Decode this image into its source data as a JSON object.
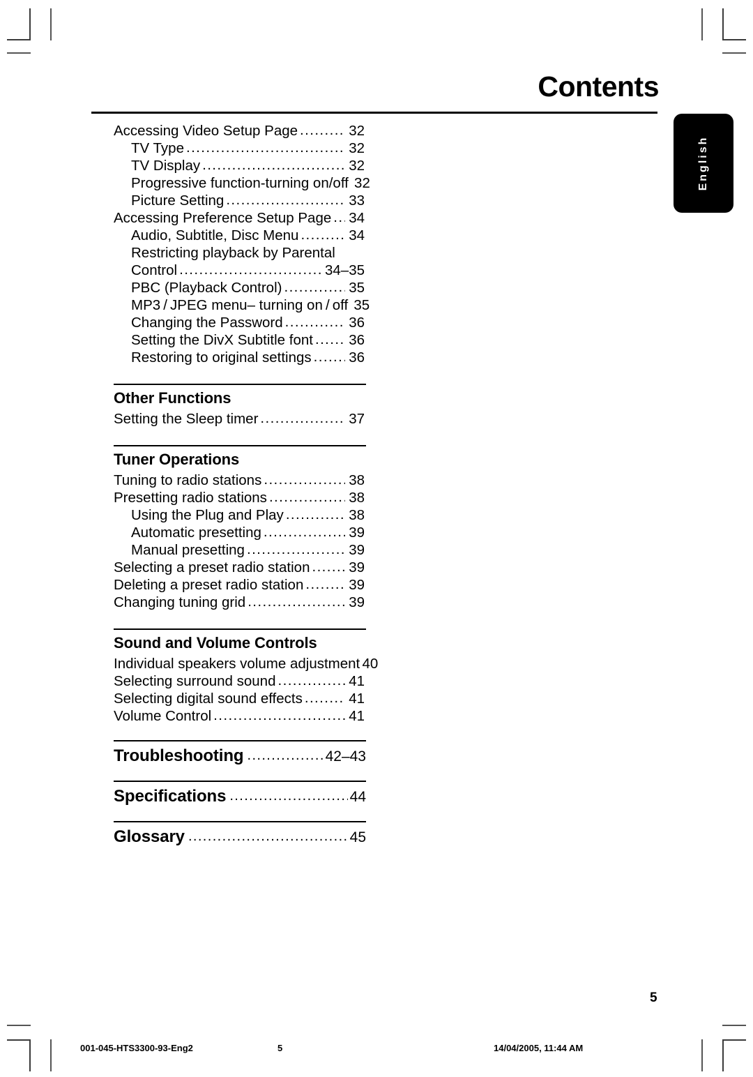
{
  "header": {
    "title": "Contents",
    "language_tab": "English"
  },
  "toc": {
    "top_entries": [
      {
        "label": "Accessing Video Setup Page",
        "page": "32",
        "indent": false
      },
      {
        "label": "TV Type",
        "page": "32",
        "indent": true
      },
      {
        "label": "TV Display ",
        "page": "32",
        "indent": true
      },
      {
        "label": "Progressive function-turning on/off",
        "page": "32",
        "indent": true
      },
      {
        "label": "Picture Setting",
        "page": "33",
        "indent": true
      },
      {
        "label": "Accessing Preference Setup Page",
        "page": "34",
        "indent": false
      },
      {
        "label": "Audio, Subtitle, Disc Menu",
        "page": "34",
        "indent": true
      },
      {
        "label": "Restricting playback by Parental",
        "page": "",
        "indent": true
      },
      {
        "label": "Control",
        "page": "34–35",
        "indent": false
      },
      {
        "label": "PBC (Playback Control)",
        "page": "35",
        "indent": false
      },
      {
        "label": "MP3 / JPEG menu– turning on / off",
        "page": "35",
        "indent": false
      },
      {
        "label": "Changing the Password",
        "page": "36",
        "indent": false
      },
      {
        "label": "Setting the DivX Subtitle font",
        "page": "36",
        "indent": false
      },
      {
        "label": "Restoring to original settings",
        "page": "36",
        "indent": false
      }
    ],
    "sections": [
      {
        "title": "Other Functions",
        "entries": [
          {
            "label": "Setting the Sleep timer",
            "page": "37",
            "indent": false
          }
        ]
      },
      {
        "title": "Tuner Operations",
        "entries": [
          {
            "label": "Tuning to radio stations",
            "page": "38",
            "indent": false
          },
          {
            "label": "Presetting radio stations",
            "page": "38",
            "indent": false
          },
          {
            "label": "Using the Plug and Play",
            "page": "38",
            "indent": true
          },
          {
            "label": "Automatic presetting",
            "page": "39",
            "indent": true
          },
          {
            "label": "Manual presetting",
            "page": "39",
            "indent": true
          },
          {
            "label": "Selecting a preset radio station",
            "page": "39",
            "indent": false
          },
          {
            "label": "Deleting a preset radio station",
            "page": "39",
            "indent": false
          },
          {
            "label": "Changing tuning grid",
            "page": "39",
            "indent": false
          }
        ]
      },
      {
        "title": "Sound and Volume Controls",
        "entries": [
          {
            "label": "Individual speakers volume adjustment",
            "page": "40",
            "indent": false,
            "noleader": true
          },
          {
            "label": "Selecting surround sound",
            "page": "41",
            "indent": false
          },
          {
            "label": "Selecting digital sound effects",
            "page": "41",
            "indent": false
          },
          {
            "label": "Volume Control",
            "page": "41",
            "indent": false
          }
        ]
      }
    ],
    "big_entries": [
      {
        "label": "Troubleshooting",
        "page": "42–43"
      },
      {
        "label": "Specifications",
        "page": "44"
      },
      {
        "label": "Glossary",
        "page": "45"
      }
    ]
  },
  "folio": "5",
  "footer": {
    "job_name": "001-045-HTS3300-93-Eng2",
    "page_number": "5",
    "timestamp": "14/04/2005, 11:44 AM"
  },
  "leader_dots": "......................................................................................................"
}
